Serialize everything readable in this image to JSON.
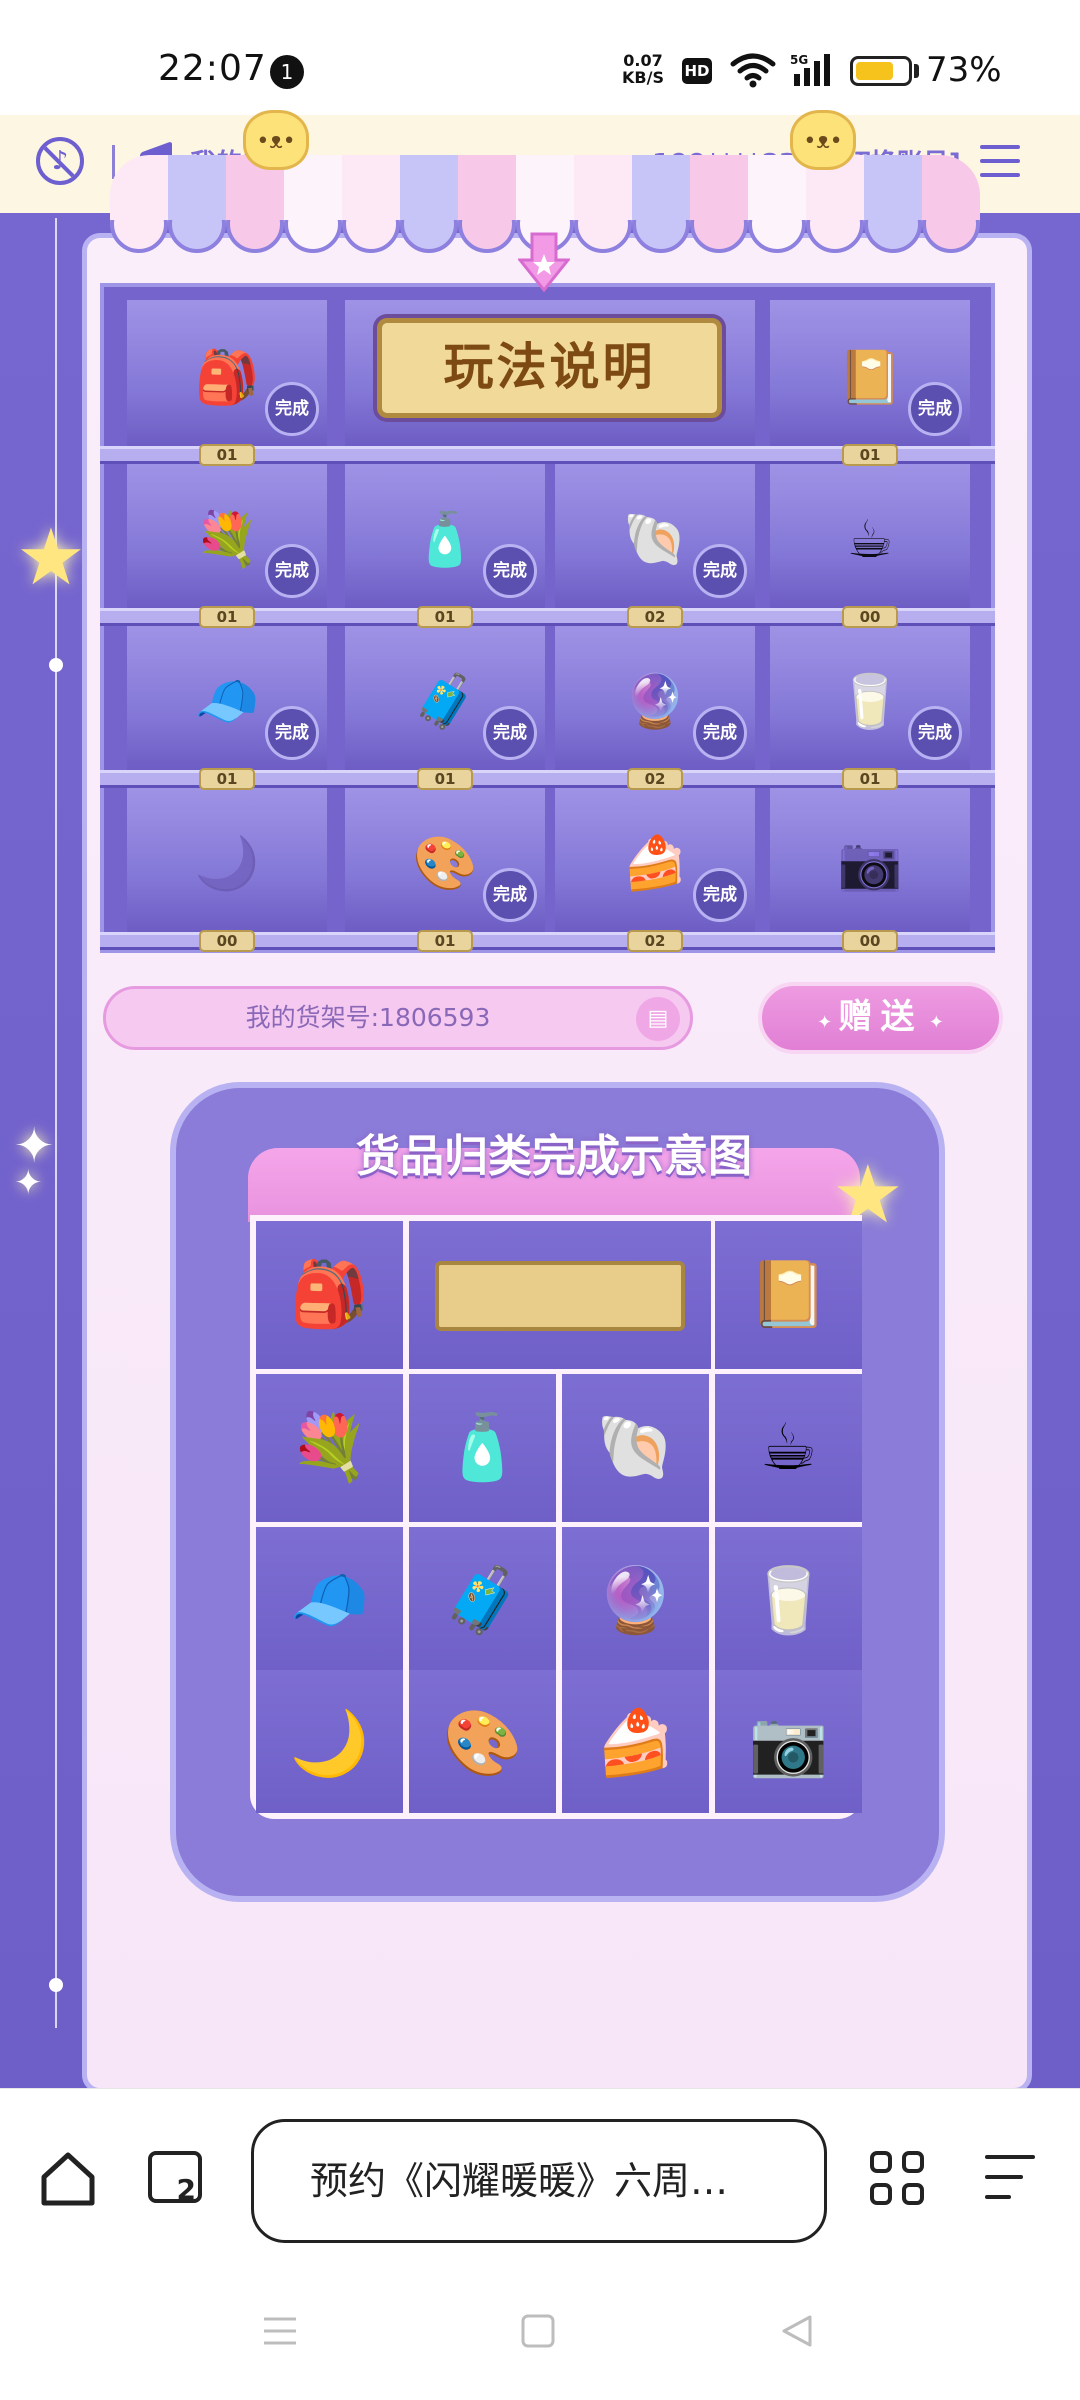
{
  "status_bar": {
    "time": "22:07",
    "notification_count": "1",
    "net_speed_value": "0.07",
    "net_speed_unit": "KB/S",
    "hd": "HD",
    "signal_type": "5G",
    "battery_percent": "73%",
    "battery_level": 0.73,
    "battery_color": "#f6c21c"
  },
  "header": {
    "coupon_label": "我的券码",
    "account_label": "199****8385[切换账号]",
    "music_icon": "music-off-icon",
    "menu_icon": "hamburger-icon"
  },
  "shelf": {
    "play_button_label": "玩法说明",
    "complete_label": "完成",
    "rows": [
      [
        {
          "item": "bunny-backpack",
          "icon": "🎒",
          "count": "01",
          "complete": true
        },
        {
          "item": "play-button-slot",
          "icon": "",
          "count": "",
          "complete": false
        },
        {
          "item": "play-button-slot",
          "icon": "",
          "count": "",
          "complete": false
        },
        {
          "item": "photo-album",
          "icon": "📔",
          "count": "01",
          "complete": true
        }
      ],
      [
        {
          "item": "flower-basket",
          "icon": "💐",
          "count": "01",
          "complete": true
        },
        {
          "item": "perfume-bottle",
          "icon": "🧴",
          "count": "01",
          "complete": true
        },
        {
          "item": "shell-ring-box",
          "icon": "🐚",
          "count": "02",
          "complete": true
        },
        {
          "item": "bunny-mug",
          "icon": "☕",
          "count": "00",
          "complete": false
        }
      ],
      [
        {
          "item": "cat-ear-hat",
          "icon": "🧢",
          "count": "01",
          "complete": true
        },
        {
          "item": "suitcase",
          "icon": "🧳",
          "count": "01",
          "complete": true
        },
        {
          "item": "crystal-ball",
          "icon": "🔮",
          "count": "02",
          "complete": true
        },
        {
          "item": "milk-carton",
          "icon": "🥛",
          "count": "01",
          "complete": true
        }
      ],
      [
        {
          "item": "moon-pillow",
          "icon": "🌙",
          "count": "00",
          "complete": false
        },
        {
          "item": "nikki-eyeshadow",
          "icon": "🎨",
          "count": "01",
          "complete": true
        },
        {
          "item": "cake-slice",
          "icon": "🍰",
          "count": "02",
          "complete": true
        },
        {
          "item": "camera",
          "icon": "📷",
          "count": "00",
          "complete": false
        }
      ]
    ]
  },
  "shelf_number": {
    "label": "我的货架号:1806593",
    "copy_icon": "copy-icon"
  },
  "gift_button_label": "赠送",
  "board": {
    "title": "货品归类完成示意图",
    "cells": [
      {
        "item": "bunny-backpack",
        "icon": "🎒"
      },
      {
        "item": "play-button-placeholder",
        "icon": ""
      },
      {
        "item": "photo-album",
        "icon": "📔"
      },
      {
        "item": "flower-basket",
        "icon": "💐"
      },
      {
        "item": "perfume-bottle",
        "icon": "🧴"
      },
      {
        "item": "shell-ring-box",
        "icon": "🐚"
      },
      {
        "item": "bunny-mug",
        "icon": "☕"
      },
      {
        "item": "cat-ear-hat",
        "icon": "🧢"
      },
      {
        "item": "suitcase",
        "icon": "🧳"
      },
      {
        "item": "crystal-ball",
        "icon": "🔮"
      },
      {
        "item": "milk-carton",
        "icon": "🥛"
      },
      {
        "item": "moon-pillow",
        "icon": "🌙"
      },
      {
        "item": "nikki-eyeshadow",
        "icon": "🎨"
      },
      {
        "item": "cake-slice",
        "icon": "🍰"
      },
      {
        "item": "camera",
        "icon": "📷"
      }
    ]
  },
  "browser_bar": {
    "tab_count": "2",
    "search_text": "预约《闪耀暖暖》六周…",
    "home_icon": "home-icon",
    "tabs_icon": "tabs-icon",
    "apps_icon": "grid-icon",
    "menu_icon": "menu-icon"
  },
  "colors": {
    "primary_purple": "#7666d0",
    "panel_pink": "#fbeefb",
    "gift_pink": "#e17fd5",
    "header_cream": "#fdf6e2"
  }
}
